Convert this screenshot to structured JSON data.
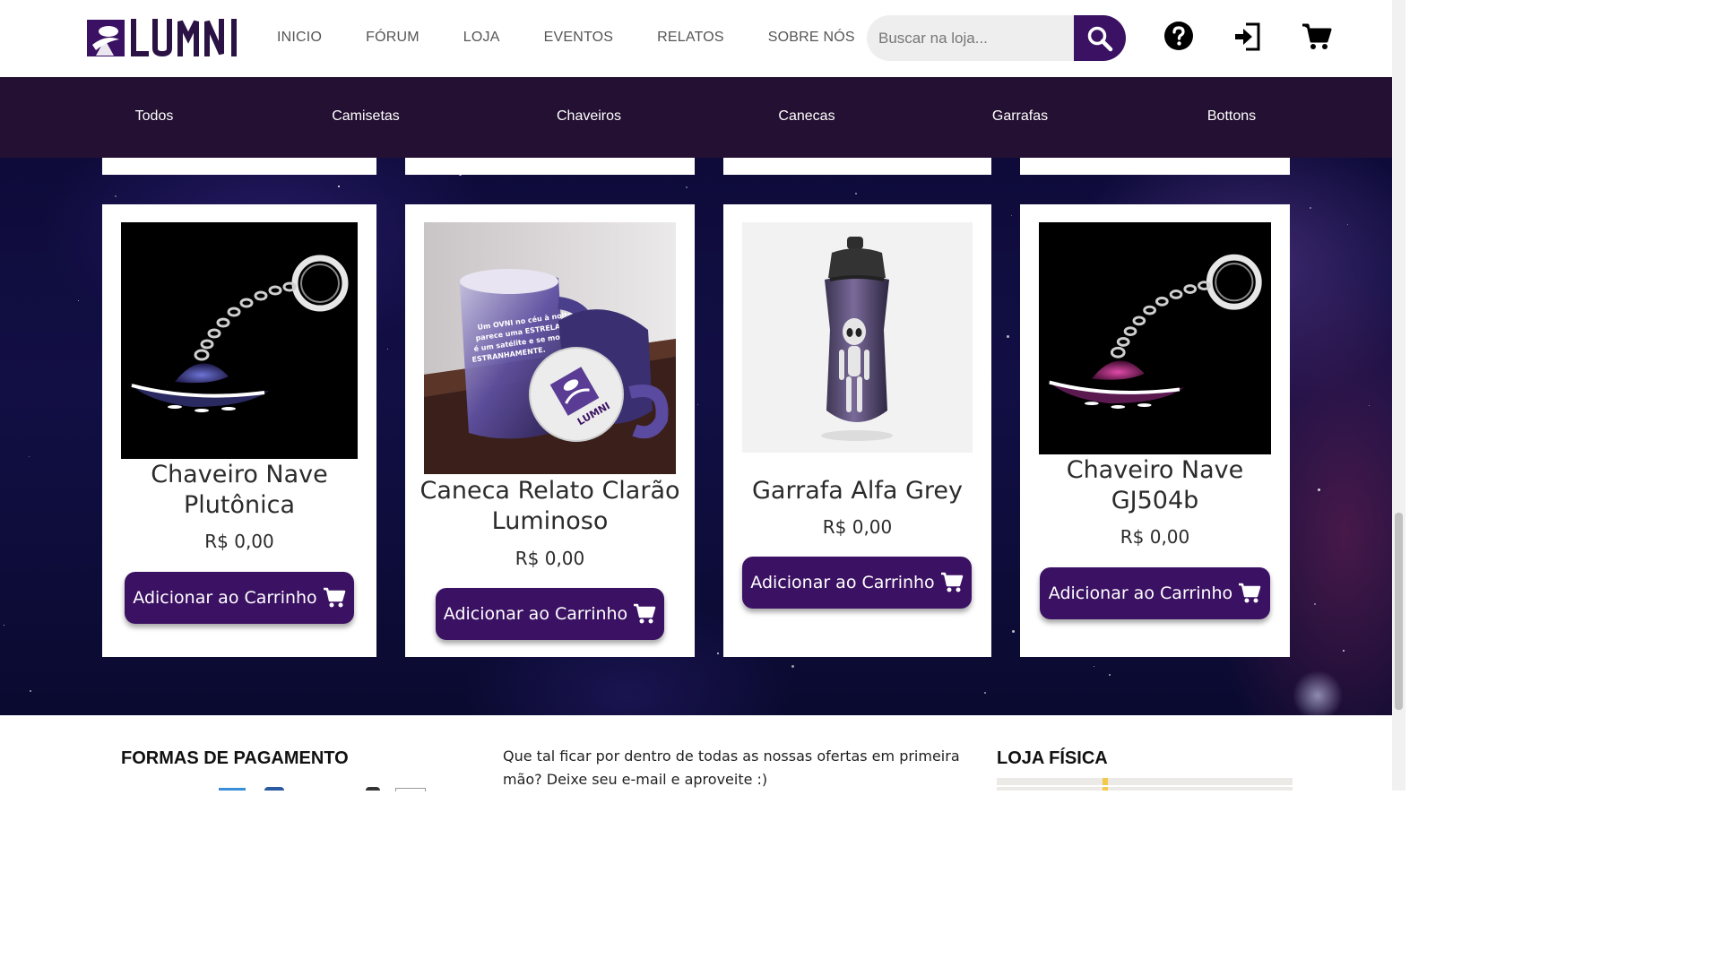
{
  "header": {
    "brand": "LUMNI",
    "nav": [
      "INICIO",
      "FÓRUM",
      "LOJA",
      "EVENTOS",
      "RELATOS",
      "SOBRE NÓS"
    ],
    "search_placeholder": "Buscar na loja...",
    "icons": [
      "search-icon",
      "help-icon",
      "login-icon",
      "cart-icon"
    ]
  },
  "categories": [
    "Todos",
    "Camisetas",
    "Chaveiros",
    "Canecas",
    "Garrafas",
    "Bottons"
  ],
  "products": [
    {
      "name": "Chaveiro Nave Plutônica",
      "price": "R$ 0,00",
      "button": "Adicionar ao Carrinho",
      "image_icon": "ufo-keychain-blue"
    },
    {
      "name": "Caneca Relato Clarão Luminoso",
      "price": "R$ 0,00",
      "button": "Adicionar ao Carrinho",
      "image_icon": "mug"
    },
    {
      "name": "Garrafa Alfa Grey",
      "price": "R$ 0,00",
      "button": "Adicionar ao Carrinho",
      "image_icon": "bottle-alien"
    },
    {
      "name": "Chaveiro Nave GJ504b",
      "price": "R$ 0,00",
      "button": "Adicionar ao Carrinho",
      "image_icon": "ufo-keychain-pink"
    }
  ],
  "mug_text": [
    "Um OVNI no céu à noite",
    "parece uma ESTRELA. Não",
    "é um satélite e se move",
    "ESTRANHAMENTE."
  ],
  "footer": {
    "payment_title": "FORMAS DE PAGAMENTO",
    "newsletter_text_1": "Que tal ficar por dentro de todas as nossas ofertas em primeira",
    "newsletter_text_2": "mão? Deixe seu e-mail e aproveite :)",
    "store_title": "LOJA FÍSICA"
  },
  "colors": {
    "primary": "#3b1163",
    "category_bar": "#241032",
    "text": "#2b2b2b"
  }
}
